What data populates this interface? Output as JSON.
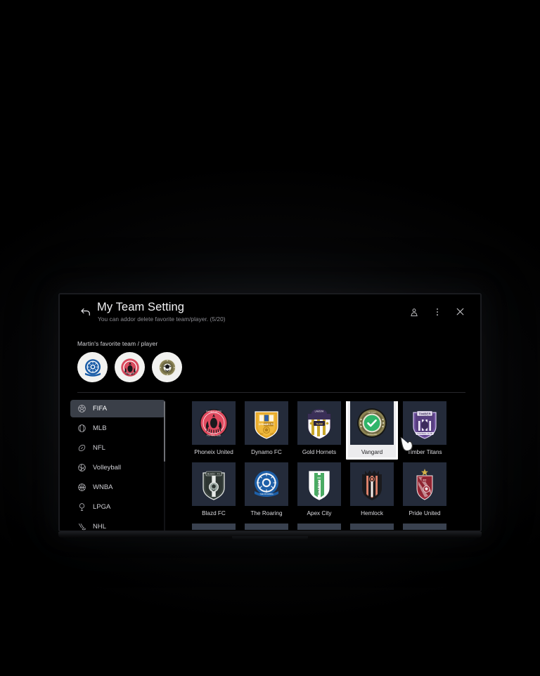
{
  "window": {
    "title": "My Team Setting",
    "subtitle": "You can addor delete favorite team/player. (5/20)",
    "back_icon": "back-arrow-icon",
    "actions": [
      {
        "name": "profile-icon",
        "label": "Profile"
      },
      {
        "name": "more-options-icon",
        "label": "More options"
      },
      {
        "name": "close-icon",
        "label": "Close"
      }
    ]
  },
  "favorites": {
    "label": "Martin's favorite team / player",
    "items": [
      {
        "name": "favorite-avatar-blue",
        "color": "#1c5ea8"
      },
      {
        "name": "favorite-avatar-red",
        "color": "#d94a5e"
      },
      {
        "name": "favorite-avatar-olive",
        "color": "#8a8355"
      }
    ]
  },
  "sidebar": {
    "items": [
      {
        "label": "FIFA",
        "icon": "soccer-ball-icon",
        "selected": true
      },
      {
        "label": "MLB",
        "icon": "baseball-icon",
        "selected": false
      },
      {
        "label": "NFL",
        "icon": "football-icon",
        "selected": false
      },
      {
        "label": "Volleyball",
        "icon": "volleyball-icon",
        "selected": false
      },
      {
        "label": "WNBA",
        "icon": "basketball-icon",
        "selected": false
      },
      {
        "label": "LPGA",
        "icon": "golf-icon",
        "selected": false
      },
      {
        "label": "NHL",
        "icon": "hockey-icon",
        "selected": false
      }
    ]
  },
  "grid": {
    "rows": [
      [
        {
          "label": "Phoneix United",
          "logo": "phoenix-crest",
          "selected": false
        },
        {
          "label": "Dynamo FC",
          "logo": "dynamo-shield",
          "selected": false
        },
        {
          "label": "Gold Hornets",
          "logo": "hornets-shield",
          "selected": false
        },
        {
          "label": "Vangard",
          "logo": "vangard-medallion",
          "selected": true
        },
        {
          "label": "Timber Titans",
          "logo": "timber-shield",
          "selected": false
        }
      ],
      [
        {
          "label": "Blazd FC",
          "logo": "blazd-shield",
          "selected": false
        },
        {
          "label": "The Roaring",
          "logo": "roaring-crest",
          "selected": false
        },
        {
          "label": "Apex City",
          "logo": "apex-shield",
          "selected": false
        },
        {
          "label": "Hemlock",
          "logo": "hemlock-shield",
          "selected": false
        },
        {
          "label": "Pride United",
          "logo": "pride-shield",
          "selected": false
        }
      ]
    ]
  },
  "colors": {
    "screen_bg": "#000000",
    "tile_bg": "#242b3a",
    "sidebar_active": "#3a3f48",
    "selection_border": "#fdfdfd",
    "check_green": "#2fb56a"
  }
}
